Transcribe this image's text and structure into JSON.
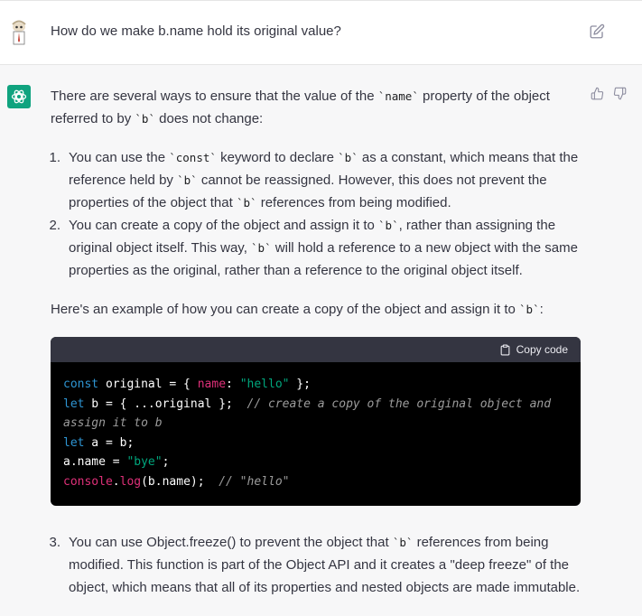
{
  "user_message": {
    "text": "How do we make b.name hold its original value?"
  },
  "assistant_message": {
    "intro": {
      "before": "There are several ways to ensure that the value of the ",
      "code1": "`name`",
      "middle": " property of the object referred to by ",
      "code2": "`b`",
      "after": " does not change:"
    },
    "list": [
      {
        "num": "1.",
        "parts": [
          {
            "t": "You can use the "
          },
          {
            "c": "`const`"
          },
          {
            "t": " keyword to declare "
          },
          {
            "c": "`b`"
          },
          {
            "t": " as a constant, which means that the reference held by "
          },
          {
            "c": "`b`"
          },
          {
            "t": " cannot be reassigned. However, this does not prevent the properties of the object that "
          },
          {
            "c": "`b`"
          },
          {
            "t": " references from being modified."
          }
        ]
      },
      {
        "num": "2.",
        "parts": [
          {
            "t": "You can create a copy of the object and assign it to "
          },
          {
            "c": "`b`"
          },
          {
            "t": ", rather than assigning the original object itself. This way, "
          },
          {
            "c": "`b`"
          },
          {
            "t": " will hold a reference to a new object with the same properties as the original, rather than a reference to the original object itself."
          }
        ]
      }
    ],
    "example_intro": {
      "before": "Here's an example of how you can create a copy of the object and assign it to ",
      "code": "`b`",
      "after": ":"
    },
    "code_block": {
      "copy_label": "Copy code",
      "lines": [
        [
          {
            "k": "kw",
            "v": "const"
          },
          {
            "k": "",
            "v": " original = { "
          },
          {
            "k": "prop",
            "v": "name"
          },
          {
            "k": "",
            "v": ": "
          },
          {
            "k": "str",
            "v": "\"hello\""
          },
          {
            "k": "",
            "v": " };"
          }
        ],
        [
          {
            "k": "kw",
            "v": "let"
          },
          {
            "k": "",
            "v": " b = { ...original };  "
          },
          {
            "k": "cmt",
            "v": "// create a copy of the original object and assign it to b"
          }
        ],
        [
          {
            "k": "kw",
            "v": "let"
          },
          {
            "k": "",
            "v": " a = b;"
          }
        ],
        [
          {
            "k": "",
            "v": "a.name = "
          },
          {
            "k": "str",
            "v": "\"bye\""
          },
          {
            "k": "",
            "v": ";"
          }
        ],
        [
          {
            "k": "fn",
            "v": "console"
          },
          {
            "k": "",
            "v": "."
          },
          {
            "k": "fn",
            "v": "log"
          },
          {
            "k": "",
            "v": "(b.name);  "
          },
          {
            "k": "cmt",
            "v": "// \"hello\""
          }
        ]
      ]
    },
    "list2": [
      {
        "num": "3.",
        "parts": [
          {
            "t": "You can use Object.freeze() to prevent the object that "
          },
          {
            "c": "`b`"
          },
          {
            "t": " references from being modified. This function is part of the Object API and it creates a \"deep freeze\" of the object, which means that all of its properties and nested objects are made immutable."
          }
        ]
      }
    ]
  },
  "icons": {
    "edit": "edit-icon",
    "thumb_up": "thumbs-up-icon",
    "thumb_down": "thumbs-down-icon",
    "copy": "clipboard-icon",
    "brand_color": "#10a37f"
  }
}
